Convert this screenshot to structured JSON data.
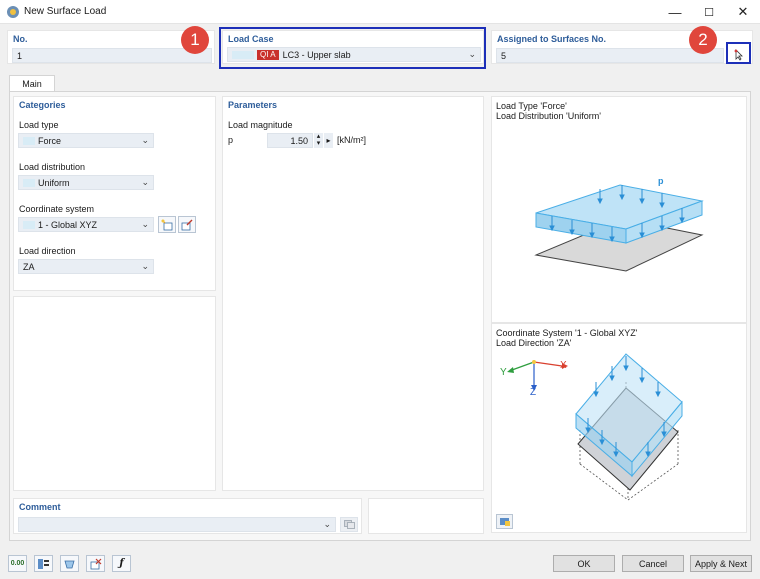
{
  "window": {
    "title": "New Surface Load"
  },
  "no": {
    "label": "No.",
    "value": "1"
  },
  "load_case": {
    "label": "Load Case",
    "tag": "QI A",
    "value": "LC3 - Upper slab"
  },
  "assigned": {
    "label": "Assigned to Surfaces No.",
    "value": "5"
  },
  "callouts": [
    "1",
    "2"
  ],
  "tabs": [
    {
      "label": "Main"
    }
  ],
  "categories": {
    "header": "Categories",
    "load_type": {
      "label": "Load type",
      "value": "Force"
    },
    "load_distribution": {
      "label": "Load distribution",
      "value": "Uniform"
    },
    "coordinate_system": {
      "label": "Coordinate system",
      "value": "1 - Global XYZ"
    },
    "load_direction": {
      "label": "Load direction",
      "value": "ZA"
    }
  },
  "parameters": {
    "header": "Parameters",
    "load_magnitude_label": "Load magnitude",
    "symbol": "p",
    "value": "1.50",
    "unit": "[kN/m²]"
  },
  "preview_top": {
    "line1": "Load Type 'Force'",
    "line2": "Load Distribution 'Uniform'",
    "p_label": "p"
  },
  "preview_bottom": {
    "line1": "Coordinate System '1 - Global XYZ'",
    "line2": "Load Direction 'ZA'",
    "axis_x": "X",
    "axis_y": "Y",
    "axis_z": "Z"
  },
  "comment": {
    "label": "Comment",
    "value": ""
  },
  "footer": {
    "ok": "OK",
    "cancel": "Cancel",
    "apply_next": "Apply & Next",
    "units_icon_text": "0.00"
  },
  "colors": {
    "accent_blue": "#2e5d9a",
    "callout_red": "#e0463c",
    "highlight_box": "#1d2fb8",
    "load_cyan": "#49aee6"
  }
}
